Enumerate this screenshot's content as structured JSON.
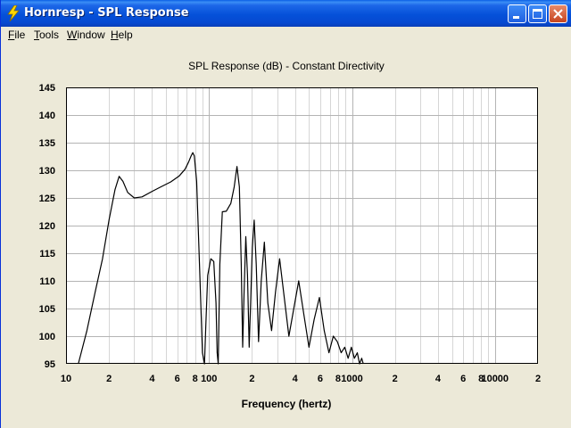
{
  "window": {
    "title": "Hornresp - SPL Response",
    "icon": "lightning-icon",
    "controls": [
      "minimize-icon",
      "maximize-icon",
      "close-icon"
    ]
  },
  "menu": {
    "items": [
      {
        "label": "File",
        "accel": "F",
        "rest": "ile"
      },
      {
        "label": "Tools",
        "accel": "T",
        "rest": "ools"
      },
      {
        "label": "Window",
        "accel": "W",
        "rest": "indow"
      },
      {
        "label": "Help",
        "accel": "H",
        "rest": "elp"
      }
    ]
  },
  "chart_data": {
    "type": "line",
    "title": "SPL Response (dB) - Constant Directivity",
    "xlabel": "Frequency (hertz)",
    "ylabel": "",
    "xscale": "log",
    "xlim": [
      10,
      20000
    ],
    "ylim": [
      95,
      145
    ],
    "ytick_labels": [
      "145",
      "140",
      "135",
      "130",
      "125",
      "120",
      "115",
      "110",
      "105",
      "100",
      "95"
    ],
    "xtick_labels": [
      "10",
      "2",
      "4",
      "6",
      "8",
      "100",
      "2",
      "4",
      "6",
      "8",
      "1000",
      "2",
      "4",
      "6",
      "8",
      "10000",
      "2"
    ],
    "grid": true,
    "line_color": "#000000",
    "series": [
      {
        "x": [
          12.2,
          14,
          16,
          18,
          20,
          22,
          23.5,
          25,
          27,
          30,
          34,
          40,
          46,
          54,
          62,
          68,
          72,
          75,
          77,
          79,
          82,
          86,
          90,
          93,
          95,
          98,
          103,
          108,
          112,
          114,
          116,
          119,
          124,
          132,
          142,
          150,
          157,
          163,
          168,
          172,
          176,
          181,
          186,
          191,
          196,
          201,
          207,
          214,
          222,
          232,
          244,
          258,
          274,
          292,
          312,
          336,
          362,
          392,
          424,
          460,
          500,
          544,
          592,
          640,
          690,
          740,
          790,
          840,
          890,
          940,
          990,
          1040,
          1090,
          1130,
          1170,
          1200
        ],
        "y": [
          95,
          101,
          108,
          114,
          121,
          126.5,
          128.9,
          128,
          126,
          125,
          125.2,
          126.2,
          127,
          127.9,
          129,
          130.2,
          131.5,
          132.6,
          133.2,
          132.6,
          128,
          112,
          97,
          95,
          102,
          111,
          114,
          113.5,
          106,
          97,
          95,
          113,
          122.5,
          122.6,
          124,
          127,
          130.7,
          127,
          113,
          98,
          108,
          118,
          111,
          98,
          107,
          116,
          121,
          113,
          99,
          110,
          117,
          106,
          101,
          108,
          114,
          107,
          100,
          105,
          110,
          104,
          98,
          103,
          107,
          101,
          97,
          100,
          99,
          97,
          98,
          96,
          98,
          96,
          97,
          95,
          96,
          95
        ]
      }
    ]
  }
}
